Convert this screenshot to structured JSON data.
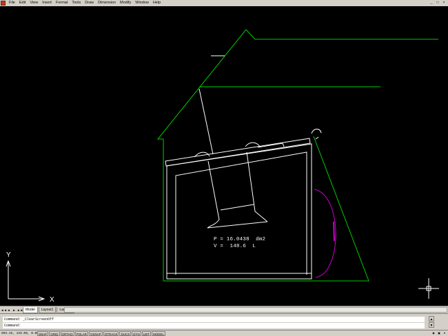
{
  "menubar": {
    "items": [
      "File",
      "Edit",
      "View",
      "Insert",
      "Format",
      "Tools",
      "Draw",
      "Dimension",
      "Modify",
      "Window",
      "Help"
    ],
    "controls": [
      "_",
      "□",
      "×"
    ]
  },
  "drawing": {
    "area_text": "P = 16.0438  dm2",
    "volume_text": "V =  148.6  L",
    "colors": {
      "outline": "#00cc00",
      "geometry": "#ffffff",
      "accent": "#cc00cc",
      "background": "#000000"
    }
  },
  "ucs_icon": {
    "x_label": "X",
    "y_label": "Y"
  },
  "tabs": {
    "nav": [
      "◄◄",
      "◄",
      "►",
      "►►"
    ],
    "items": [
      "Model",
      "Layout1",
      "Layout2"
    ],
    "active": "Model"
  },
  "command": {
    "line1": "Command: _ClearScreenOff",
    "line2": "Command:"
  },
  "status": {
    "coords": "993.15, 133.00, 0.00",
    "toggles": [
      "SNAP",
      "GRID",
      "ORTHO",
      "POLAR",
      "OSNAP",
      "OTRACK",
      "DUCS",
      "DYN",
      "LWT",
      "MODEL"
    ]
  }
}
